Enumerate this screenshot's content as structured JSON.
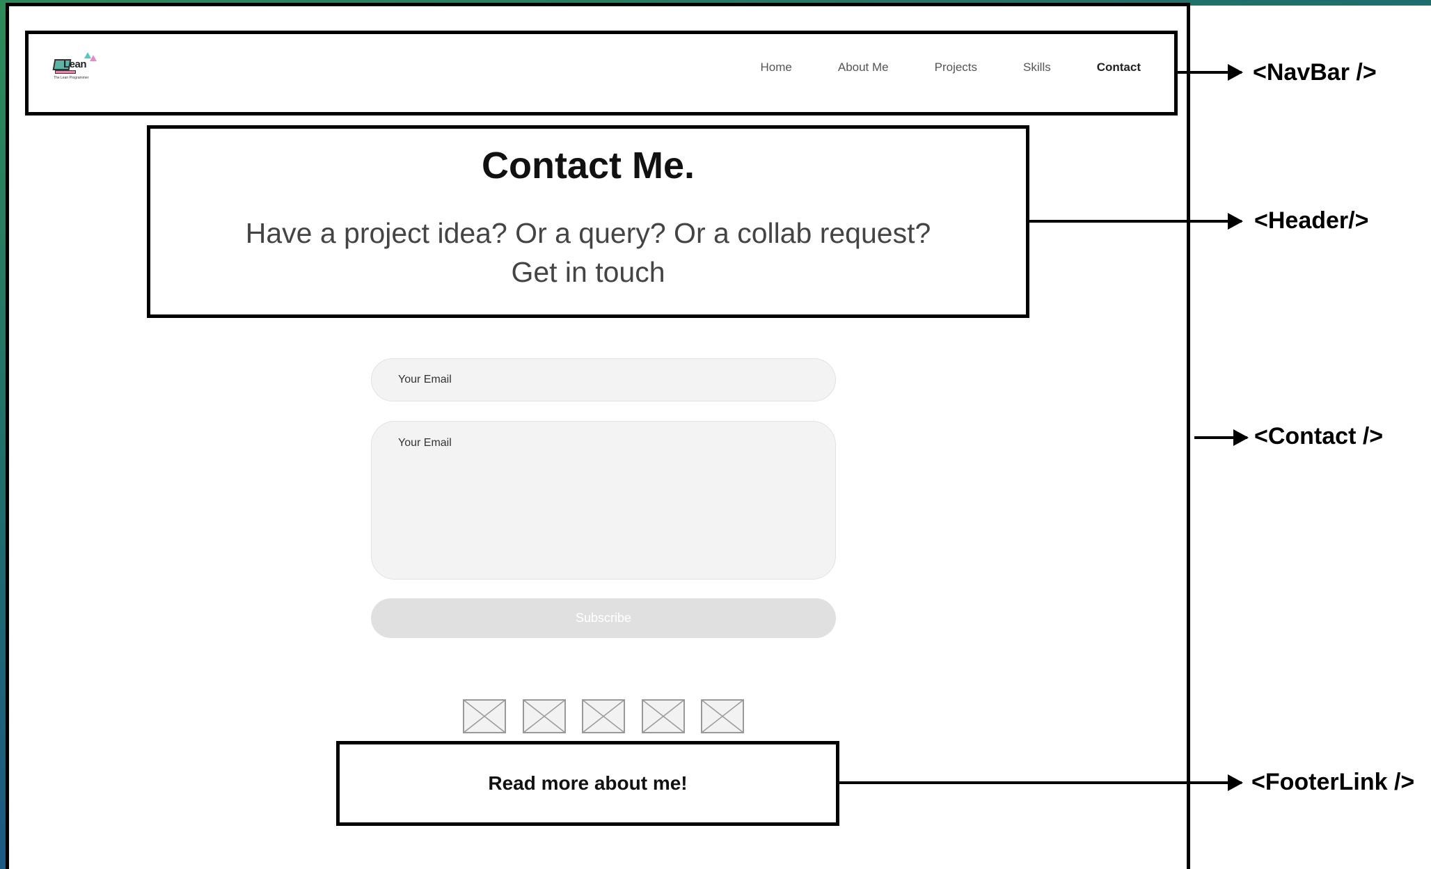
{
  "navbar": {
    "logo_text": "Lean",
    "logo_subtext": "The Lean Programmer",
    "links": [
      {
        "label": "Home"
      },
      {
        "label": "About Me"
      },
      {
        "label": "Projects"
      },
      {
        "label": "Skills"
      },
      {
        "label": "Contact"
      }
    ],
    "active_link": "Contact"
  },
  "header": {
    "title": "Contact Me.",
    "subtitle_line1": "Have a project idea? Or a query? Or a collab request?",
    "subtitle_line2": "Get in touch"
  },
  "contact": {
    "email_placeholder": "Your Email",
    "message_placeholder": "Your Email",
    "submit_label": "Subscribe",
    "social_icons": [
      "image-placeholder-icon",
      "image-placeholder-icon",
      "image-placeholder-icon",
      "image-placeholder-icon",
      "image-placeholder-icon"
    ]
  },
  "footer_link": {
    "label": "Read more about me!"
  },
  "annotations": {
    "navbar": "<NavBar />",
    "header": "<Header/>",
    "contact": "<Contact />",
    "footer": "<FooterLink />"
  },
  "colors": {
    "background_gradient_start": "#2e8b57",
    "background_gradient_end": "#163e7a",
    "input_fill": "#f3f3f3",
    "button_fill": "#e0e0e0",
    "border": "#000000"
  }
}
